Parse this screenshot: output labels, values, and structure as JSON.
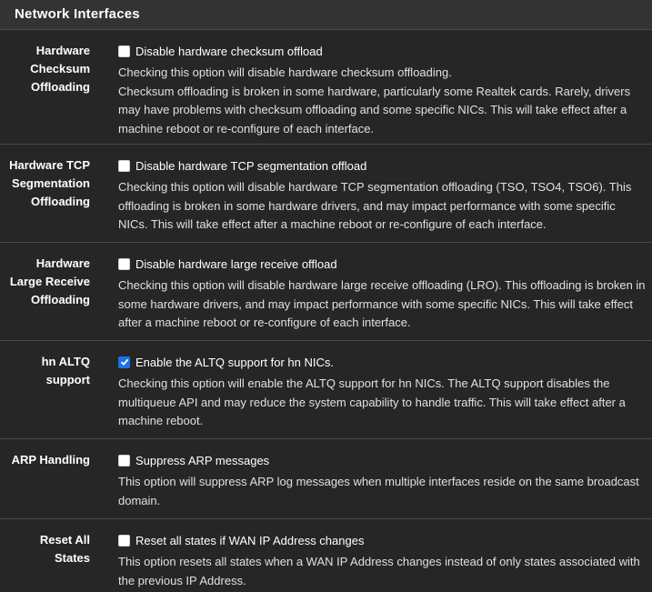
{
  "panel": {
    "title": "Network Interfaces"
  },
  "rows": [
    {
      "label": "Hardware Checksum Offloading",
      "checkbox_label": "Disable hardware checksum offload",
      "checked": false,
      "help": [
        "Checking this option will disable hardware checksum offloading.",
        "Checksum offloading is broken in some hardware, particularly some Realtek cards. Rarely, drivers may have problems with checksum offloading and some specific NICs. This will take effect after a machine reboot or re-configure of each interface."
      ]
    },
    {
      "label": "Hardware TCP Segmentation Offloading",
      "checkbox_label": "Disable hardware TCP segmentation offload",
      "checked": false,
      "help": [
        "Checking this option will disable hardware TCP segmentation offloading (TSO, TSO4, TSO6). This offloading is broken in some hardware drivers, and may impact performance with some specific NICs. This will take effect after a machine reboot or re-configure of each interface."
      ]
    },
    {
      "label": "Hardware Large Receive Offloading",
      "checkbox_label": "Disable hardware large receive offload",
      "checked": false,
      "help": [
        "Checking this option will disable hardware large receive offloading (LRO). This offloading is broken in some hardware drivers, and may impact performance with some specific NICs. This will take effect after a machine reboot or re-configure of each interface."
      ]
    },
    {
      "label": "hn ALTQ support",
      "checkbox_label": "Enable the ALTQ support for hn NICs.",
      "checked": true,
      "help": [
        "Checking this option will enable the ALTQ support for hn NICs. The ALTQ support disables the multiqueue API and may reduce the system capability to handle traffic. This will take effect after a machine reboot."
      ]
    },
    {
      "label": "ARP Handling",
      "checkbox_label": "Suppress ARP messages",
      "checked": false,
      "help": [
        "This option will suppress ARP log messages when multiple interfaces reside on the same broadcast domain."
      ]
    },
    {
      "label": "Reset All States",
      "checkbox_label": "Reset all states if WAN IP Address changes",
      "checked": false,
      "help": [
        "This option resets all states when a WAN IP Address changes instead of only states associated with the previous IP Address."
      ]
    }
  ],
  "colors": {
    "checkbox_checked": "#1a73e8",
    "panel_heading_bg": "#333333",
    "panel_bg": "#262626"
  },
  "icons": {
    "checkmark": "check-icon"
  }
}
